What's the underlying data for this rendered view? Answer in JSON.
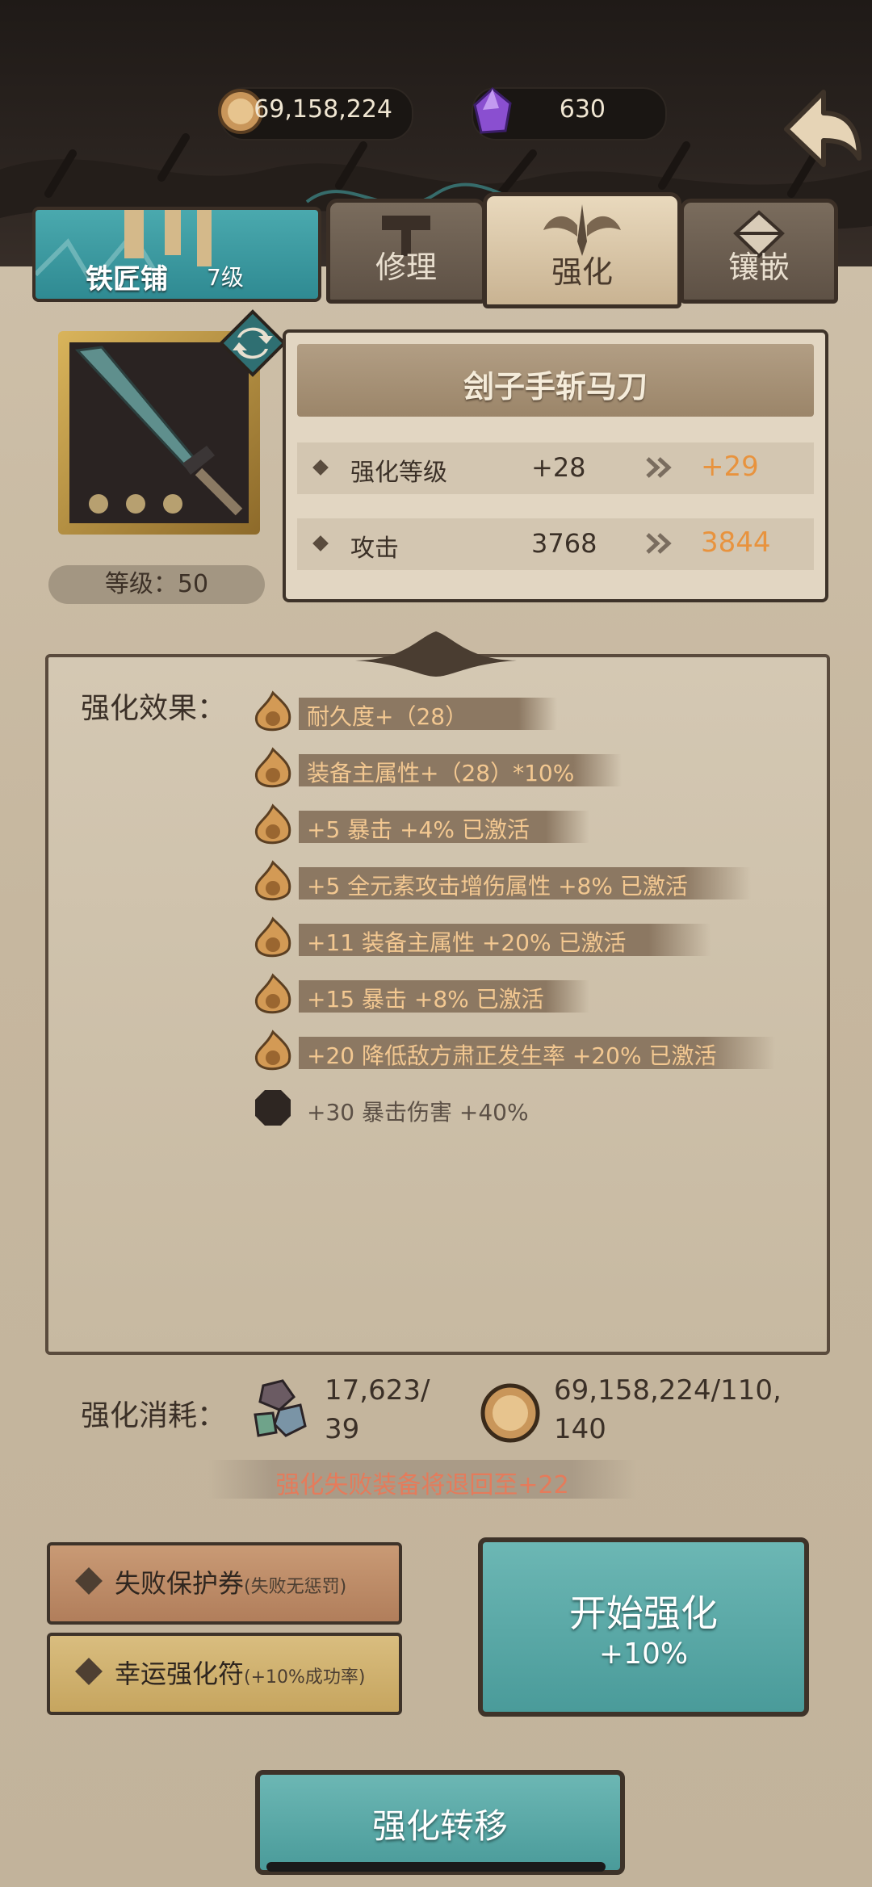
{
  "resources": {
    "gold": "69,158,224",
    "gems": "630"
  },
  "tabs": {
    "smithy_label": "铁匠铺",
    "smithy_level": "7级",
    "repair": "修理",
    "enhance": "强化",
    "inlay": "镶嵌"
  },
  "item": {
    "name": "刽子手斩马刀",
    "level_text": "等级：50",
    "stats": [
      {
        "key": "强化等级",
        "current": "+28",
        "next": "+29"
      },
      {
        "key": "攻击",
        "current": "3768",
        "next": "3844"
      }
    ]
  },
  "effects": {
    "title": "强化效果：",
    "rows": [
      {
        "text": "耐久度+（28）",
        "active": true
      },
      {
        "text": "装备主属性+（28）*10%",
        "active": true
      },
      {
        "text": "+5  暴击 +4% 已激活",
        "active": true
      },
      {
        "text": "+5  全元素攻击增伤属性 +8% 已激活",
        "active": true
      },
      {
        "text": "+11  装备主属性 +20% 已激活",
        "active": true
      },
      {
        "text": "+15  暴击 +8% 已激活",
        "active": true
      },
      {
        "text": "+20  降低敌方肃正发生率 +20% 已激活",
        "active": true
      },
      {
        "text": "+30  暴击伤害 +40%",
        "active": false
      }
    ]
  },
  "cost": {
    "title": "强化消耗：",
    "material_line1": "17,623/",
    "material_line2": "39",
    "gold_line1": "69,158,224/110,",
    "gold_line2": "140",
    "warning": "强化失败装备将退回至+22"
  },
  "buttons": {
    "protect_main": "失败保护券",
    "protect_sub": "(失败无惩罚)",
    "lucky_main": "幸运强化符",
    "lucky_sub": "(+10%成功率)",
    "start_main": "开始强化",
    "start_sub": "+10%",
    "transfer": "强化转移"
  },
  "colors": {
    "accent_orange": "#e8933e",
    "teal_button": "#5aa9a7",
    "warning_red": "#e57b5b"
  }
}
